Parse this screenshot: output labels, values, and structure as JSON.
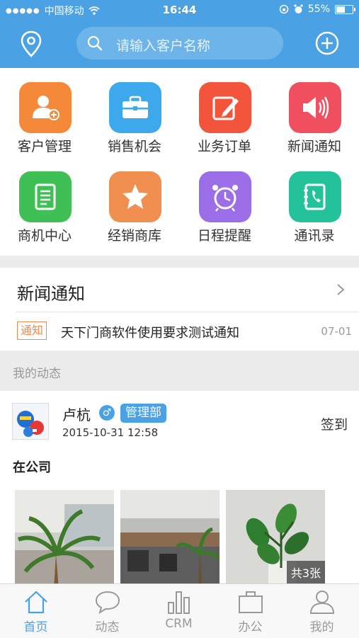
{
  "status_bar": {
    "carrier": "中国移动",
    "time": "16:44",
    "battery": "55%",
    "battery_level": 0.55
  },
  "header": {
    "search_placeholder": "请输入客户名称",
    "location_icon": "location-pin-icon",
    "add_icon": "plus-circle-icon"
  },
  "grid": [
    {
      "label": "客户管理",
      "icon": "customer-icon",
      "color": "#f5893a"
    },
    {
      "label": "销售机会",
      "icon": "briefcase-icon",
      "color": "#3ea8ec"
    },
    {
      "label": "业务订单",
      "icon": "edit-order-icon",
      "color": "#f2553b"
    },
    {
      "label": "新闻通知",
      "icon": "speaker-icon",
      "color": "#ef4f5e"
    },
    {
      "label": "商机中心",
      "icon": "document-icon",
      "color": "#3ec055"
    },
    {
      "label": "经销商库",
      "icon": "star-icon",
      "color": "#f08f4f"
    },
    {
      "label": "日程提醒",
      "icon": "alarm-clock-icon",
      "color": "#9b6ee8"
    },
    {
      "label": "通讯录",
      "icon": "contacts-phone-icon",
      "color": "#24c29b"
    }
  ],
  "news": {
    "title": "新闻通知",
    "item": {
      "tag": "通知",
      "text": "天下门商软件使用要求测试通知",
      "date": "07-01"
    }
  },
  "my_dynamics": {
    "label": "我的动态"
  },
  "post": {
    "user": "卢杭",
    "gender_symbol": "♂",
    "department": "管理部",
    "time": "2015-10-31 12:58",
    "action": "签到",
    "place": "在公司",
    "photo_count": "共3张"
  },
  "tabs": [
    {
      "label": "首页",
      "icon": "home-icon",
      "active": true
    },
    {
      "label": "动态",
      "icon": "chat-bubble-icon",
      "active": false
    },
    {
      "label": "CRM",
      "icon": "bar-chart-icon",
      "active": false
    },
    {
      "label": "办公",
      "icon": "briefcase-icon",
      "active": false
    },
    {
      "label": "我的",
      "icon": "person-icon",
      "active": false
    }
  ]
}
